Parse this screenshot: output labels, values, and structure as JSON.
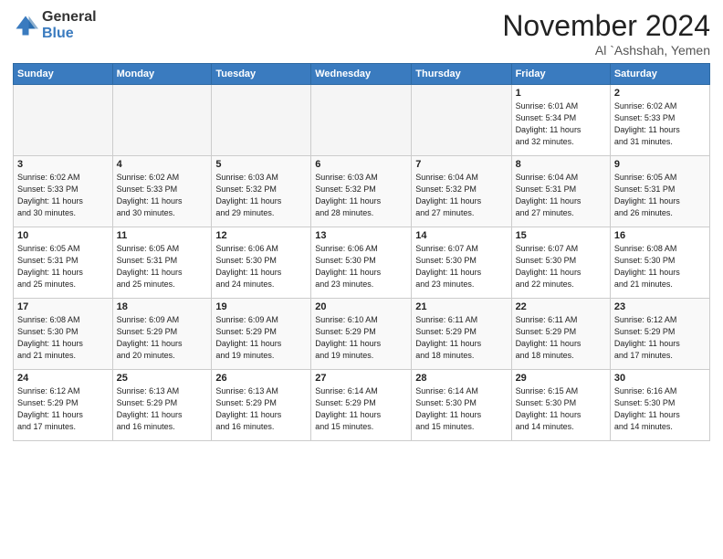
{
  "logo": {
    "general": "General",
    "blue": "Blue"
  },
  "header": {
    "month": "November 2024",
    "location": "Al `Ashshah, Yemen"
  },
  "weekdays": [
    "Sunday",
    "Monday",
    "Tuesday",
    "Wednesday",
    "Thursday",
    "Friday",
    "Saturday"
  ],
  "weeks": [
    [
      {
        "day": "",
        "info": ""
      },
      {
        "day": "",
        "info": ""
      },
      {
        "day": "",
        "info": ""
      },
      {
        "day": "",
        "info": ""
      },
      {
        "day": "",
        "info": ""
      },
      {
        "day": "1",
        "info": "Sunrise: 6:01 AM\nSunset: 5:34 PM\nDaylight: 11 hours\nand 32 minutes."
      },
      {
        "day": "2",
        "info": "Sunrise: 6:02 AM\nSunset: 5:33 PM\nDaylight: 11 hours\nand 31 minutes."
      }
    ],
    [
      {
        "day": "3",
        "info": "Sunrise: 6:02 AM\nSunset: 5:33 PM\nDaylight: 11 hours\nand 30 minutes."
      },
      {
        "day": "4",
        "info": "Sunrise: 6:02 AM\nSunset: 5:33 PM\nDaylight: 11 hours\nand 30 minutes."
      },
      {
        "day": "5",
        "info": "Sunrise: 6:03 AM\nSunset: 5:32 PM\nDaylight: 11 hours\nand 29 minutes."
      },
      {
        "day": "6",
        "info": "Sunrise: 6:03 AM\nSunset: 5:32 PM\nDaylight: 11 hours\nand 28 minutes."
      },
      {
        "day": "7",
        "info": "Sunrise: 6:04 AM\nSunset: 5:32 PM\nDaylight: 11 hours\nand 27 minutes."
      },
      {
        "day": "8",
        "info": "Sunrise: 6:04 AM\nSunset: 5:31 PM\nDaylight: 11 hours\nand 27 minutes."
      },
      {
        "day": "9",
        "info": "Sunrise: 6:05 AM\nSunset: 5:31 PM\nDaylight: 11 hours\nand 26 minutes."
      }
    ],
    [
      {
        "day": "10",
        "info": "Sunrise: 6:05 AM\nSunset: 5:31 PM\nDaylight: 11 hours\nand 25 minutes."
      },
      {
        "day": "11",
        "info": "Sunrise: 6:05 AM\nSunset: 5:31 PM\nDaylight: 11 hours\nand 25 minutes."
      },
      {
        "day": "12",
        "info": "Sunrise: 6:06 AM\nSunset: 5:30 PM\nDaylight: 11 hours\nand 24 minutes."
      },
      {
        "day": "13",
        "info": "Sunrise: 6:06 AM\nSunset: 5:30 PM\nDaylight: 11 hours\nand 23 minutes."
      },
      {
        "day": "14",
        "info": "Sunrise: 6:07 AM\nSunset: 5:30 PM\nDaylight: 11 hours\nand 23 minutes."
      },
      {
        "day": "15",
        "info": "Sunrise: 6:07 AM\nSunset: 5:30 PM\nDaylight: 11 hours\nand 22 minutes."
      },
      {
        "day": "16",
        "info": "Sunrise: 6:08 AM\nSunset: 5:30 PM\nDaylight: 11 hours\nand 21 minutes."
      }
    ],
    [
      {
        "day": "17",
        "info": "Sunrise: 6:08 AM\nSunset: 5:30 PM\nDaylight: 11 hours\nand 21 minutes."
      },
      {
        "day": "18",
        "info": "Sunrise: 6:09 AM\nSunset: 5:29 PM\nDaylight: 11 hours\nand 20 minutes."
      },
      {
        "day": "19",
        "info": "Sunrise: 6:09 AM\nSunset: 5:29 PM\nDaylight: 11 hours\nand 19 minutes."
      },
      {
        "day": "20",
        "info": "Sunrise: 6:10 AM\nSunset: 5:29 PM\nDaylight: 11 hours\nand 19 minutes."
      },
      {
        "day": "21",
        "info": "Sunrise: 6:11 AM\nSunset: 5:29 PM\nDaylight: 11 hours\nand 18 minutes."
      },
      {
        "day": "22",
        "info": "Sunrise: 6:11 AM\nSunset: 5:29 PM\nDaylight: 11 hours\nand 18 minutes."
      },
      {
        "day": "23",
        "info": "Sunrise: 6:12 AM\nSunset: 5:29 PM\nDaylight: 11 hours\nand 17 minutes."
      }
    ],
    [
      {
        "day": "24",
        "info": "Sunrise: 6:12 AM\nSunset: 5:29 PM\nDaylight: 11 hours\nand 17 minutes."
      },
      {
        "day": "25",
        "info": "Sunrise: 6:13 AM\nSunset: 5:29 PM\nDaylight: 11 hours\nand 16 minutes."
      },
      {
        "day": "26",
        "info": "Sunrise: 6:13 AM\nSunset: 5:29 PM\nDaylight: 11 hours\nand 16 minutes."
      },
      {
        "day": "27",
        "info": "Sunrise: 6:14 AM\nSunset: 5:29 PM\nDaylight: 11 hours\nand 15 minutes."
      },
      {
        "day": "28",
        "info": "Sunrise: 6:14 AM\nSunset: 5:30 PM\nDaylight: 11 hours\nand 15 minutes."
      },
      {
        "day": "29",
        "info": "Sunrise: 6:15 AM\nSunset: 5:30 PM\nDaylight: 11 hours\nand 14 minutes."
      },
      {
        "day": "30",
        "info": "Sunrise: 6:16 AM\nSunset: 5:30 PM\nDaylight: 11 hours\nand 14 minutes."
      }
    ]
  ]
}
